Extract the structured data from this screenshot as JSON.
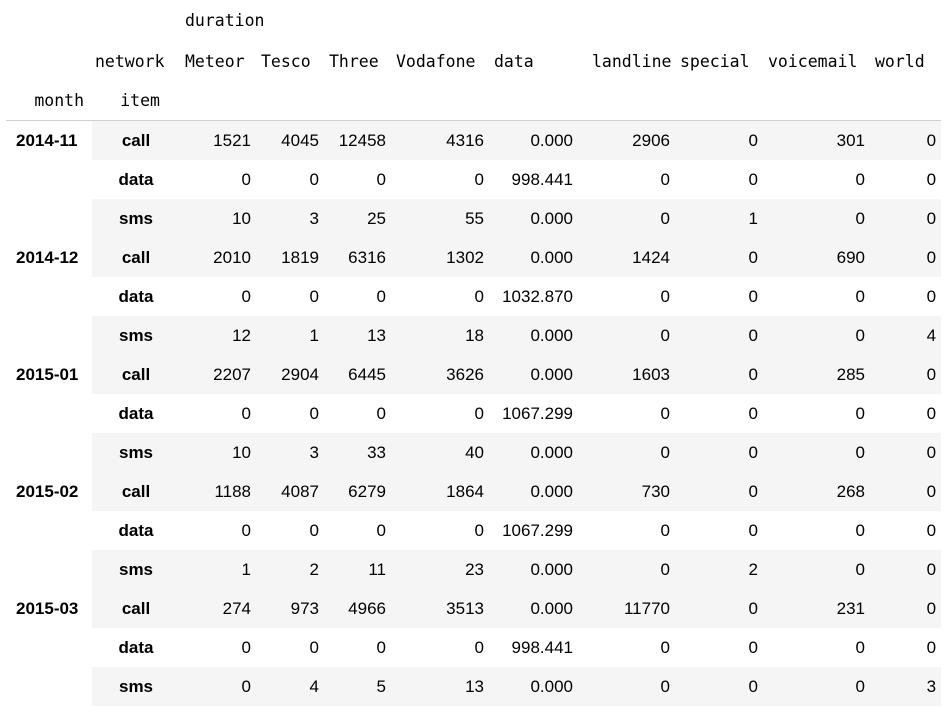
{
  "header": {
    "top_label": "duration",
    "network_label": "network",
    "columns": [
      "Meteor",
      "Tesco",
      "Three",
      "Vodafone",
      "data",
      "landline",
      "special",
      "voicemail",
      "world"
    ],
    "month_label": "month",
    "item_label": "item"
  },
  "groups": [
    {
      "month": "2014-11",
      "rows": [
        {
          "item": "call",
          "values": [
            "1521",
            "4045",
            "12458",
            "4316",
            "0.000",
            "2906",
            "0",
            "301",
            "0"
          ]
        },
        {
          "item": "data",
          "values": [
            "0",
            "0",
            "0",
            "0",
            "998.441",
            "0",
            "0",
            "0",
            "0"
          ]
        },
        {
          "item": "sms",
          "values": [
            "10",
            "3",
            "25",
            "55",
            "0.000",
            "0",
            "1",
            "0",
            "0"
          ]
        }
      ]
    },
    {
      "month": "2014-12",
      "rows": [
        {
          "item": "call",
          "values": [
            "2010",
            "1819",
            "6316",
            "1302",
            "0.000",
            "1424",
            "0",
            "690",
            "0"
          ]
        },
        {
          "item": "data",
          "values": [
            "0",
            "0",
            "0",
            "0",
            "1032.870",
            "0",
            "0",
            "0",
            "0"
          ]
        },
        {
          "item": "sms",
          "values": [
            "12",
            "1",
            "13",
            "18",
            "0.000",
            "0",
            "0",
            "0",
            "4"
          ]
        }
      ]
    },
    {
      "month": "2015-01",
      "rows": [
        {
          "item": "call",
          "values": [
            "2207",
            "2904",
            "6445",
            "3626",
            "0.000",
            "1603",
            "0",
            "285",
            "0"
          ]
        },
        {
          "item": "data",
          "values": [
            "0",
            "0",
            "0",
            "0",
            "1067.299",
            "0",
            "0",
            "0",
            "0"
          ]
        },
        {
          "item": "sms",
          "values": [
            "10",
            "3",
            "33",
            "40",
            "0.000",
            "0",
            "0",
            "0",
            "0"
          ]
        }
      ]
    },
    {
      "month": "2015-02",
      "rows": [
        {
          "item": "call",
          "values": [
            "1188",
            "4087",
            "6279",
            "1864",
            "0.000",
            "730",
            "0",
            "268",
            "0"
          ]
        },
        {
          "item": "data",
          "values": [
            "0",
            "0",
            "0",
            "0",
            "1067.299",
            "0",
            "0",
            "0",
            "0"
          ]
        },
        {
          "item": "sms",
          "values": [
            "1",
            "2",
            "11",
            "23",
            "0.000",
            "0",
            "2",
            "0",
            "0"
          ]
        }
      ]
    },
    {
      "month": "2015-03",
      "rows": [
        {
          "item": "call",
          "values": [
            "274",
            "973",
            "4966",
            "3513",
            "0.000",
            "11770",
            "0",
            "231",
            "0"
          ]
        },
        {
          "item": "data",
          "values": [
            "0",
            "0",
            "0",
            "0",
            "998.441",
            "0",
            "0",
            "0",
            "0"
          ]
        },
        {
          "item": "sms",
          "values": [
            "0",
            "4",
            "5",
            "13",
            "0.000",
            "0",
            "0",
            "0",
            "3"
          ]
        }
      ]
    }
  ]
}
